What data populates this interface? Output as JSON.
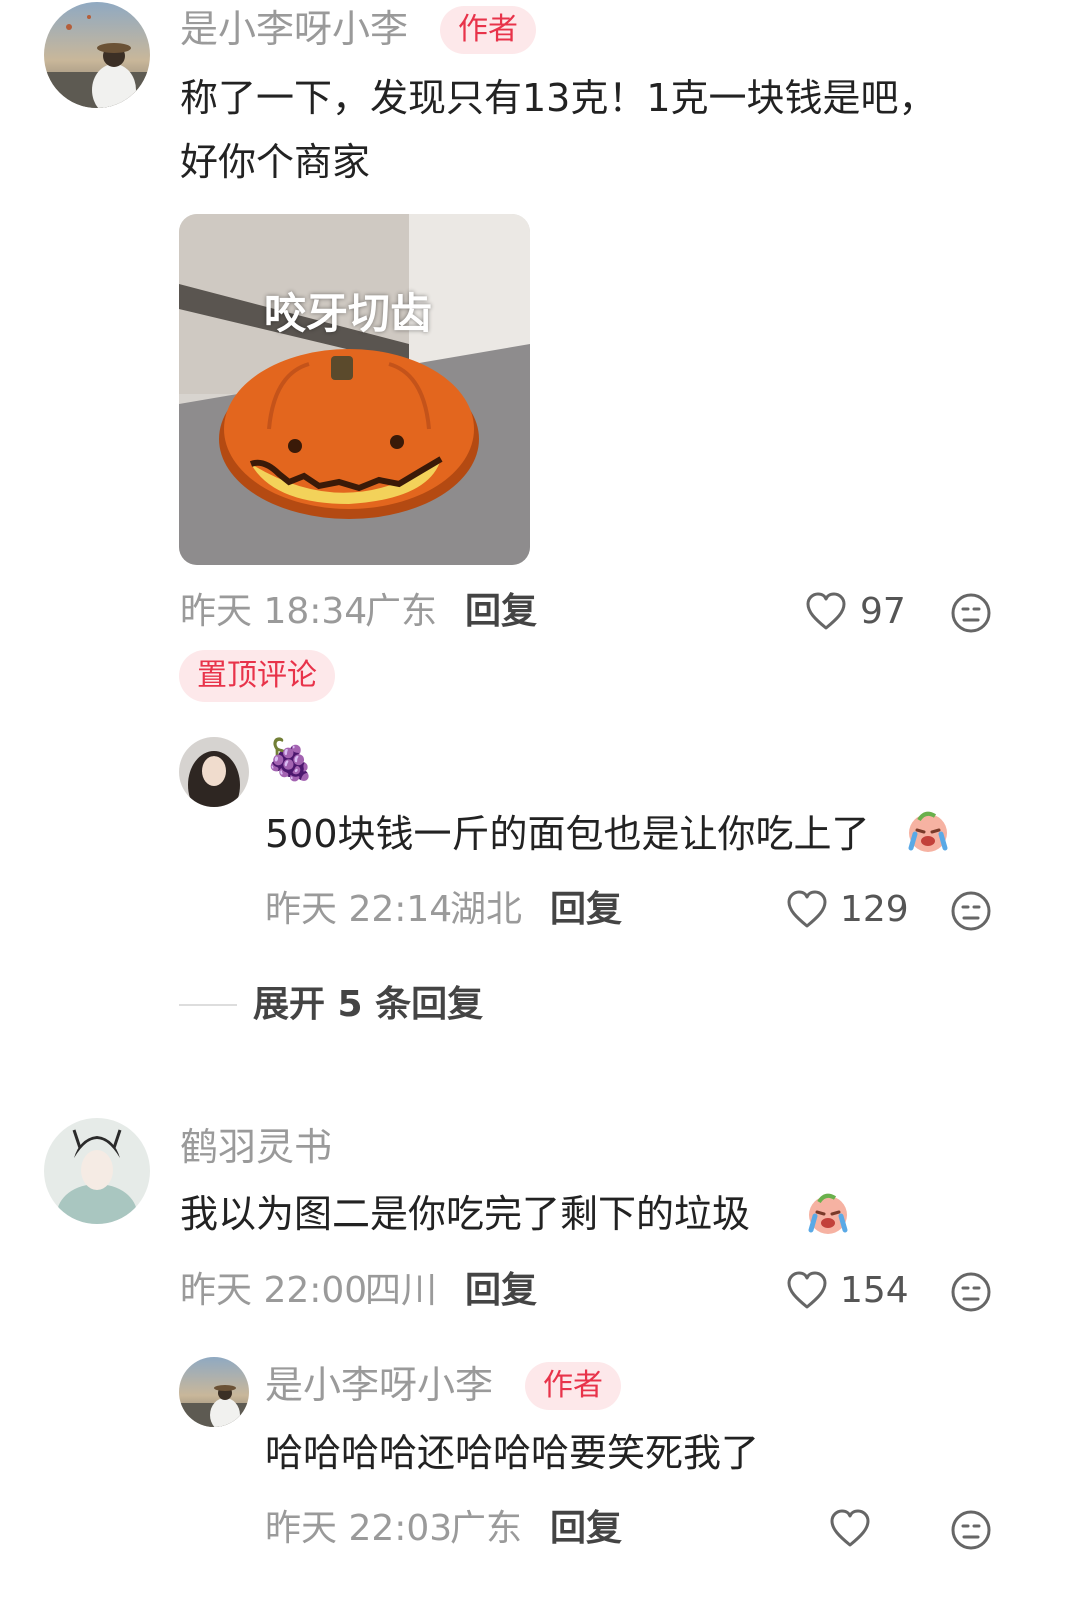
{
  "comments": [
    {
      "author": "是小李呀小李",
      "badge": "作者",
      "text_line1": "称了一下，发现只有13克！1克一块钱是吧，",
      "text_line2": "好你个商家",
      "image_caption": "咬牙切齿",
      "time": "昨天 18:34",
      "location": "广东",
      "reply_label": "回复",
      "likes": "97",
      "pinned_label": "置顶评论",
      "replies": [
        {
          "author_emoji": "🍇",
          "text": "500块钱一斤的面包也是让你吃上了",
          "time": "昨天 22:14",
          "location": "湖北",
          "reply_label": "回复",
          "likes": "129"
        }
      ],
      "expand_label": "展开 5 条回复"
    },
    {
      "author": "鹤羽灵书",
      "text": "我以为图二是你吃完了剩下的垃圾",
      "time": "昨天 22:00",
      "location": "四川",
      "reply_label": "回复",
      "likes": "154",
      "replies": [
        {
          "author": "是小李呀小李",
          "badge": "作者",
          "text": "哈哈哈哈还哈哈哈要笑死我了",
          "time": "昨天 22:03",
          "location": "广东",
          "reply_label": "回复",
          "likes": ""
        }
      ]
    }
  ],
  "colors": {
    "accent": "#e8334a",
    "badge_bg": "#fde8ea",
    "meta_gray": "#9a9a9a"
  },
  "icons": [
    "heart-outline-icon",
    "neutral-face-icon",
    "grapes-emoji",
    "crying-face-emoji"
  ]
}
